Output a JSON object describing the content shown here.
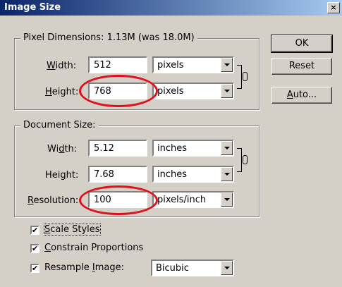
{
  "window": {
    "title": "Image Size",
    "close_glyph": "×"
  },
  "pixel_dimensions": {
    "legend": "Pixel Dimensions:  1.13M (was 18.0M)",
    "width": {
      "label_pre": "",
      "label_acc": "W",
      "label_post": "idth:",
      "value": "512",
      "unit": "pixels"
    },
    "height": {
      "label_pre": "",
      "label_acc": "H",
      "label_post": "eight:",
      "value": "768",
      "unit": "pixels"
    }
  },
  "document_size": {
    "legend": "Document Size:",
    "width": {
      "label_pre": "Wi",
      "label_acc": "d",
      "label_post": "th:",
      "value": "5.12",
      "unit": "inches"
    },
    "height": {
      "label_pre": "Hei",
      "label_acc": "g",
      "label_post": "ht:",
      "value": "7.68",
      "unit": "inches"
    },
    "resolution": {
      "label_pre": "",
      "label_acc": "R",
      "label_post": "esolution:",
      "value": "100",
      "unit": "pixels/inch"
    }
  },
  "buttons": {
    "ok": "OK",
    "reset": "Reset",
    "auto_acc": "A",
    "auto_rest": "uto..."
  },
  "options": {
    "scale_styles": {
      "acc": "S",
      "rest": "cale Styles",
      "checked": true
    },
    "constrain": {
      "acc": "C",
      "rest": "onstrain Proportions",
      "checked": true
    },
    "resample": {
      "pre": "Resample ",
      "acc": "I",
      "rest": "mage:",
      "checked": true,
      "method": "Bicubic"
    }
  },
  "check_glyph": "✔",
  "highlight_color": "#e0101a"
}
